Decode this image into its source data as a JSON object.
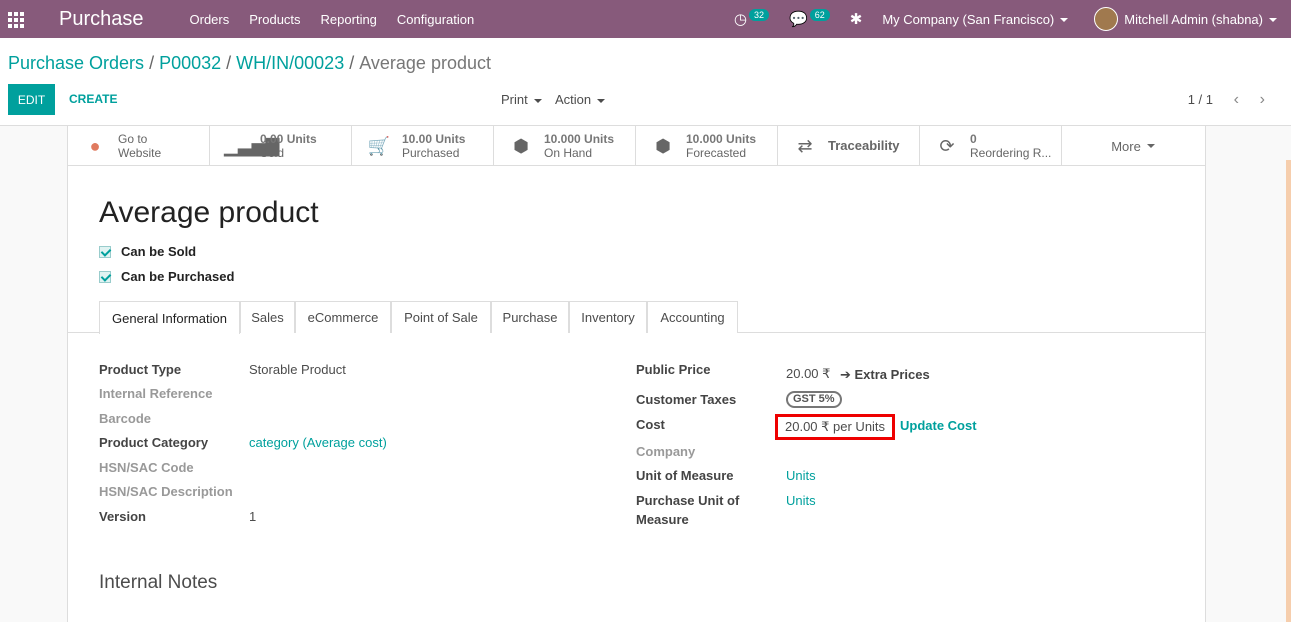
{
  "navbar": {
    "app_name": "Purchase",
    "menu": [
      "Orders",
      "Products",
      "Reporting",
      "Configuration"
    ],
    "activity_count": "32",
    "messages_count": "62",
    "company": "My Company (San Francisco)",
    "user": "Mitchell Admin (shabna)"
  },
  "breadcrumb": {
    "items": [
      "Purchase Orders",
      "P00032",
      "WH/IN/00023"
    ],
    "current": "Average product"
  },
  "toolbar": {
    "edit_label": "EDIT",
    "create_label": "CREATE",
    "print_label": "Print",
    "action_label": "Action",
    "pager": "1 / 1"
  },
  "stat_buttons": [
    {
      "line1": "Go to",
      "line2": "Website",
      "icon": "globe-icon"
    },
    {
      "line1": "0.00 Units",
      "line2": "Sold",
      "icon": "bar-chart-icon"
    },
    {
      "line1": "10.00 Units",
      "line2": "Purchased",
      "icon": "cart-icon"
    },
    {
      "line1": "10.000 Units",
      "line2": "On Hand",
      "icon": "cubes-icon"
    },
    {
      "line1": "10.000 Units",
      "line2": "Forecasted",
      "icon": "cubes-icon"
    },
    {
      "line1": "Traceability",
      "icon": "exchange-icon"
    },
    {
      "line1": "0",
      "line2": "Reordering R...",
      "icon": "refresh-icon"
    },
    {
      "line1": "More"
    }
  ],
  "product": {
    "name": "Average product",
    "can_be_sold": "Can be Sold",
    "can_be_purchased": "Can be Purchased"
  },
  "tabs": [
    "General Information",
    "Sales",
    "eCommerce",
    "Point of Sale",
    "Purchase",
    "Inventory",
    "Accounting"
  ],
  "left_fields": {
    "product_type_label": "Product Type",
    "product_type_value": "Storable Product",
    "internal_reference_label": "Internal Reference",
    "barcode_label": "Barcode",
    "product_category_label": "Product Category",
    "product_category_value": "category (Average cost)",
    "hsn_code_label": "HSN/SAC Code",
    "hsn_desc_label": "HSN/SAC Description",
    "version_label": "Version",
    "version_value": "1"
  },
  "right_fields": {
    "public_price_label": "Public Price",
    "public_price_value": "20.00 ₹",
    "extra_prices_label": "Extra Prices",
    "customer_taxes_label": "Customer Taxes",
    "customer_taxes_value": "GST 5%",
    "cost_label": "Cost",
    "cost_value": "20.00 ₹  per Units",
    "update_cost_label": "Update Cost",
    "company_label": "Company",
    "uom_label": "Unit of Measure",
    "uom_value": "Units",
    "purchase_uom_label_1": "Purchase Unit of",
    "purchase_uom_label_2": "Measure",
    "purchase_uom_value": "Units"
  },
  "notes": {
    "title": "Internal Notes"
  }
}
